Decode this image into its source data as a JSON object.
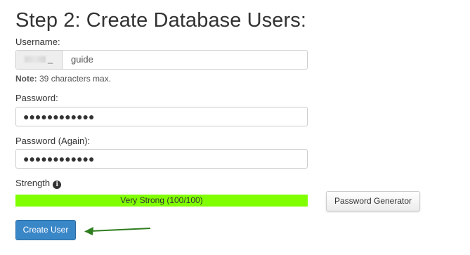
{
  "section": {
    "title": "Step 2: Create Database Users:"
  },
  "username": {
    "label": "Username:",
    "prefix_suffix": "_",
    "value": "guide",
    "note_bold": "Note:",
    "note_text": " 39 characters max."
  },
  "password": {
    "label": "Password:",
    "masked_value": "●●●●●●●●●●●●"
  },
  "password_again": {
    "label": "Password (Again):",
    "masked_value": "●●●●●●●●●●●●"
  },
  "strength": {
    "label": "Strength",
    "info_icon": "info-icon",
    "bar_text": "Very Strong (100/100)",
    "score_fraction": 1.0,
    "bar_color": "#80ff00"
  },
  "buttons": {
    "password_generator": "Password Generator",
    "create_user": "Create User"
  },
  "colors": {
    "primary_button": "#3a87c8",
    "annotation_arrow": "#2e7d1e"
  }
}
